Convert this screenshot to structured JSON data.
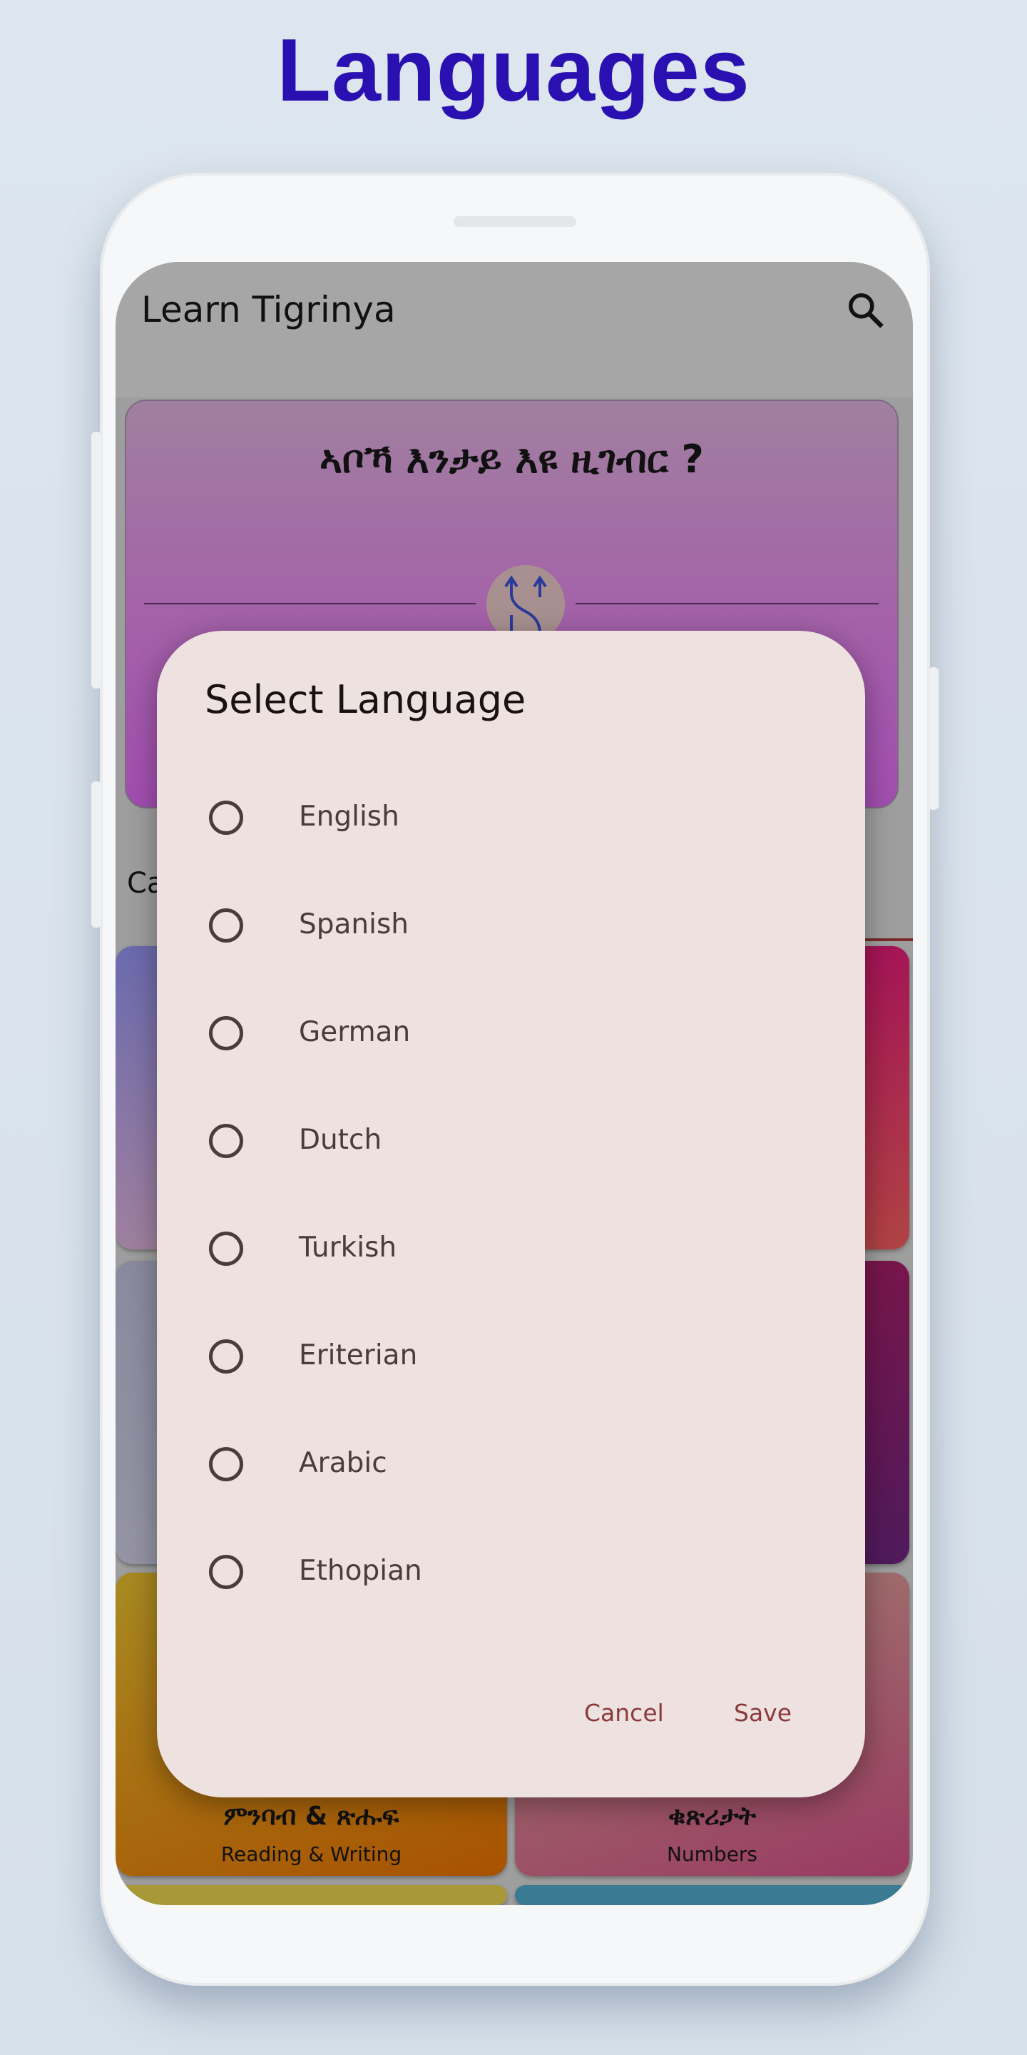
{
  "page_heading": "Languages",
  "app": {
    "title": "Learn Tigrinya",
    "search_icon": "search-icon",
    "hero_question": "ኣቦኻ እንታይ እዩ ዚገብር ?",
    "swap_icon": "swap-arrows-icon",
    "categories_label_partial": "Ca",
    "cards": [
      {
        "geez": "",
        "english": "",
        "colors": [
          "#6a6aae",
          "#b88a98"
        ]
      },
      {
        "geez": "",
        "english": "",
        "colors": [
          "#a0005e",
          "#b04444"
        ]
      },
      {
        "geez": "",
        "english": "",
        "colors": [
          "#8a8a9e",
          "#9a98a8"
        ]
      },
      {
        "geez": "",
        "english": "",
        "colors": [
          "#8a1444",
          "#4e1a5c"
        ]
      },
      {
        "geez": "ምንባብ & ጽሑፍ",
        "english": "Reading & Writing",
        "colors": [
          "#a88a22",
          "#a85200"
        ]
      },
      {
        "geez": "ቁጽሪታት",
        "english": "Numbers",
        "colors": [
          "#a08070",
          "#9a3a62"
        ]
      },
      {
        "geez": "",
        "english": "",
        "colors": [
          "#a89838",
          "#a89838"
        ]
      },
      {
        "geez": "",
        "english": "",
        "colors": [
          "#3a7a92",
          "#3a7a92"
        ]
      }
    ]
  },
  "dialog": {
    "title": "Select Language",
    "options": [
      {
        "label": "English",
        "selected": false
      },
      {
        "label": "Spanish",
        "selected": false
      },
      {
        "label": "German",
        "selected": false
      },
      {
        "label": "Dutch",
        "selected": false
      },
      {
        "label": "Turkish",
        "selected": false
      },
      {
        "label": "Eriterian",
        "selected": false
      },
      {
        "label": "Arabic",
        "selected": false
      },
      {
        "label": "Ethopian",
        "selected": false
      }
    ],
    "cancel_label": "Cancel",
    "save_label": "Save"
  },
  "colors": {
    "heading": "#2a10b0",
    "dialog_bg": "#ede2e0",
    "action_text": "#8b3a3a"
  }
}
